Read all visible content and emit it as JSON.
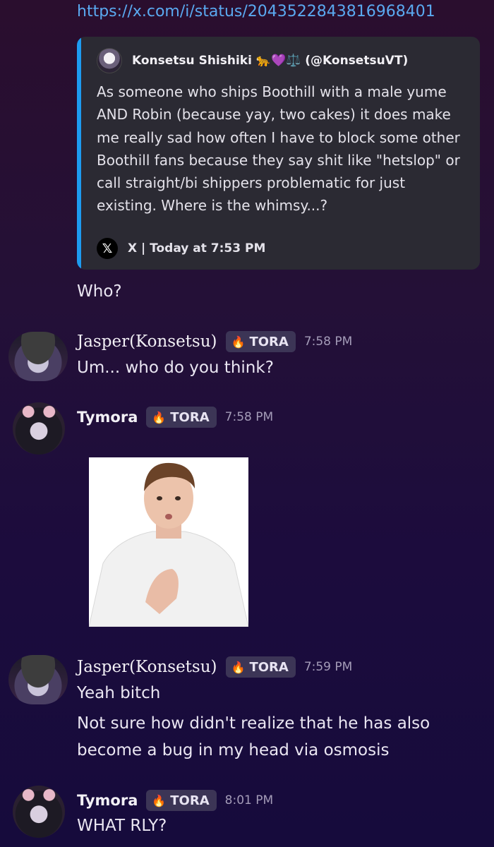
{
  "link": "https://x.com/i/status/2043522843816968401",
  "embed": {
    "author": "Konsetsu Shishiki 🐆💜⚖️ (@KonsetsuVT)",
    "text": "As someone who ships Boothill with a male yume AND Robin (because yay, two cakes) it does make me really sad how often I have to block some other Boothill fans because they say shit like \"hetslop\" or call straight/bi shippers problematic for just existing. Where is the whimsy...?",
    "x_logo": "𝕏",
    "footer": "X | Today at 7:53 PM",
    "accent_color": "#1d9bf0"
  },
  "messages": {
    "who": "Who?",
    "m1": {
      "name": "Jasper(Konsetsu)",
      "tag": "TORA",
      "time": "7:58 PM",
      "text": "Um... who do you think?"
    },
    "m2": {
      "name": "Tymora",
      "tag": "TORA",
      "time": "7:58 PM"
    },
    "m3": {
      "name": "Jasper(Konsetsu)",
      "tag": "TORA",
      "time": "7:59 PM",
      "text1": "Yeah bitch",
      "text2": "Not sure how didn't realize that he has also",
      "text3": "become a bug in my head via osmosis"
    },
    "m4": {
      "name": "Tymora",
      "tag": "TORA",
      "time": "8:01 PM",
      "text": "WHAT RLY?"
    }
  },
  "icons": {
    "tag_icon": "flame-icon"
  }
}
